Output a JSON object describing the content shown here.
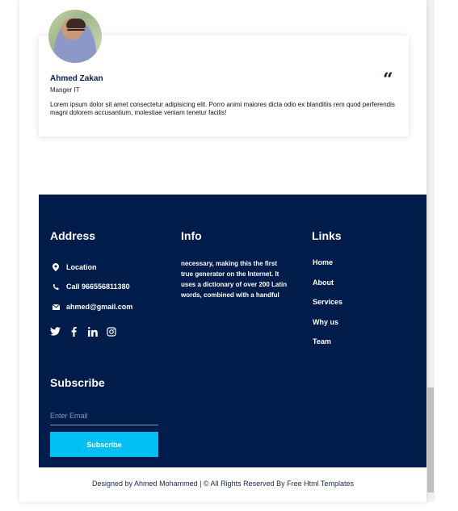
{
  "testimonial": {
    "name": "Ahmed Zakan",
    "role": "Manger IT",
    "quote_glyph": "“",
    "text": "Lorem ipsum dolor sit amet consectetur adipisicing elit. Porro animi maiores dicta odio ex blanditiis rem quod perferendis magni dolorem accusantium, molestiae veniam tenetur facilis!"
  },
  "footer": {
    "bg_color": "#001c4a",
    "address": {
      "title": "Address",
      "items": [
        {
          "icon": "location-pin-icon",
          "text": "Location"
        },
        {
          "icon": "phone-icon",
          "text": "Call 966556811380"
        },
        {
          "icon": "envelope-icon",
          "text": "ahmed@gmail.com"
        }
      ],
      "social": [
        "twitter-icon",
        "facebook-icon",
        "linkedin-icon",
        "instagram-icon"
      ]
    },
    "info": {
      "title": "Info",
      "text": "necessary, making this the first true generator on the Internet. It uses a dictionary of over 200 Latin words, combined with a handful"
    },
    "links": {
      "title": "Links",
      "items": [
        "Home",
        "About",
        "Services",
        "Why us",
        "Team"
      ]
    },
    "subscribe": {
      "title": "Subscribe",
      "placeholder": "Enter Email",
      "button_label": "Subscribe",
      "button_color": "#00bff3"
    }
  },
  "copyright": "Designed by Ahmed Mohammed | © All Rights Reserved By Free Html Templates"
}
